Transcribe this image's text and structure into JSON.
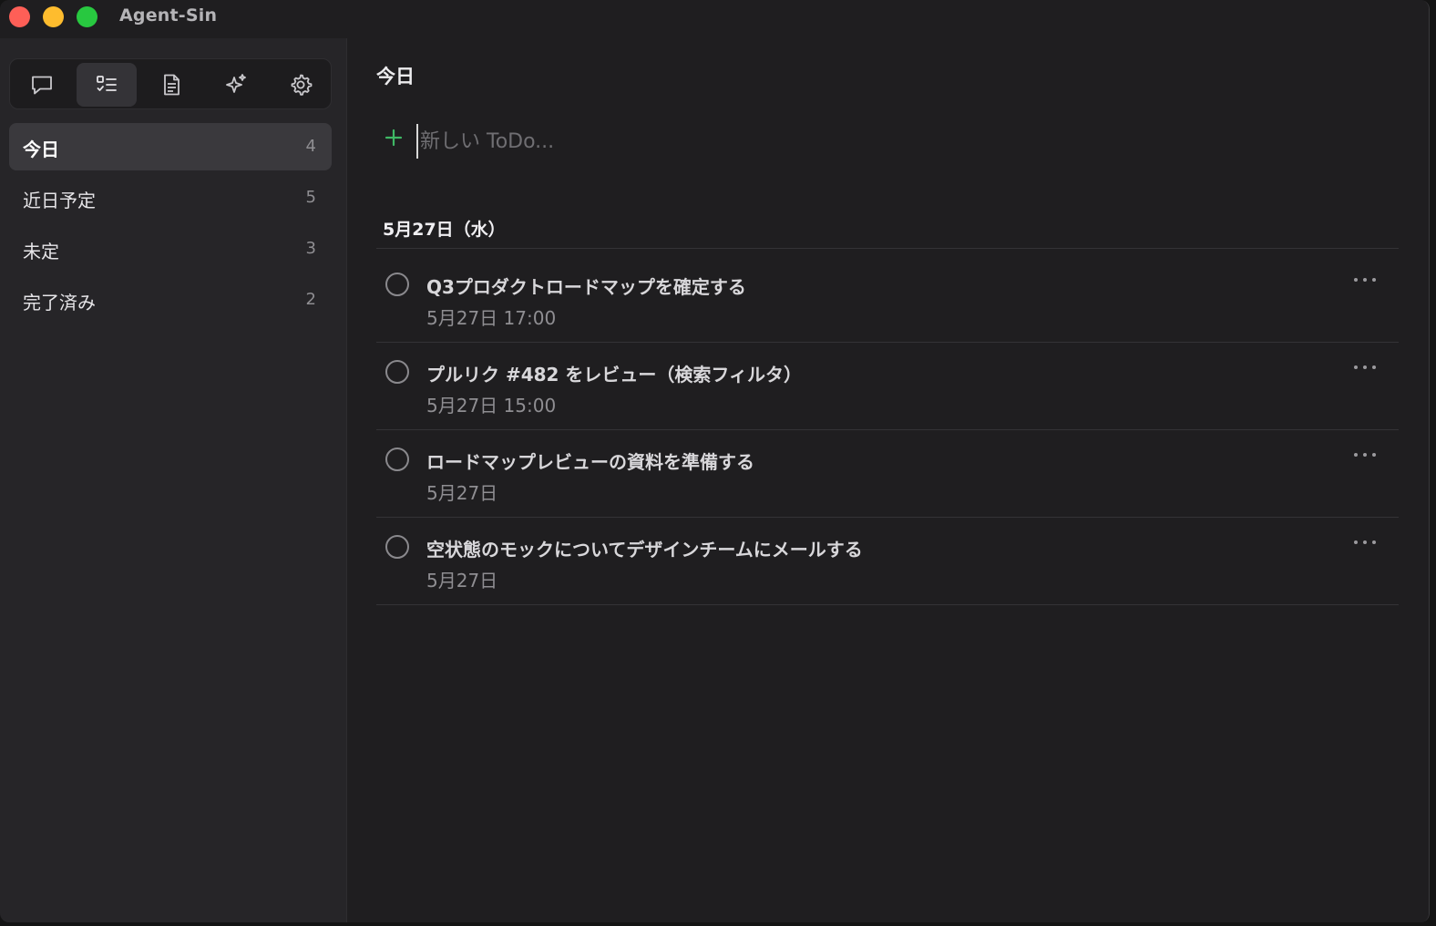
{
  "window": {
    "title": "Agent-Sin",
    "controls": [
      "close",
      "minimize",
      "maximize"
    ]
  },
  "toolbar": {
    "buttons": [
      {
        "icon": "chat-icon",
        "active": false
      },
      {
        "icon": "checklist-icon",
        "active": true
      },
      {
        "icon": "document-icon",
        "active": false
      },
      {
        "icon": "sparkle-icon",
        "active": false
      },
      {
        "icon": "gear-icon",
        "active": false
      }
    ]
  },
  "sidebar": {
    "items": [
      {
        "label": "今日",
        "count": "4",
        "active": true
      },
      {
        "label": "近日予定",
        "count": "5",
        "active": false
      },
      {
        "label": "未定",
        "count": "3",
        "active": false
      },
      {
        "label": "完了済み",
        "count": "2",
        "active": false
      }
    ]
  },
  "main": {
    "title": "今日",
    "new_todo": {
      "value": "",
      "placeholder": "新しい ToDo..."
    },
    "section": {
      "label": "5月27日（水）"
    },
    "tasks": [
      {
        "title": "Q3プロダクトロードマップを確定する",
        "due": "5月27日 17:00",
        "completed": false
      },
      {
        "title": "プルリク #482 をレビュー（検索フィルタ）",
        "due": "5月27日 15:00",
        "completed": false
      },
      {
        "title": "ロードマップレビューの資料を準備する",
        "due": "5月27日",
        "completed": false
      },
      {
        "title": "空状態のモックについてデザインチームにメールする",
        "due": "5月27日",
        "completed": false
      }
    ]
  },
  "colors": {
    "accent_green": "#3fb865",
    "background": "#1f1e20",
    "sidebar": "#262528"
  }
}
